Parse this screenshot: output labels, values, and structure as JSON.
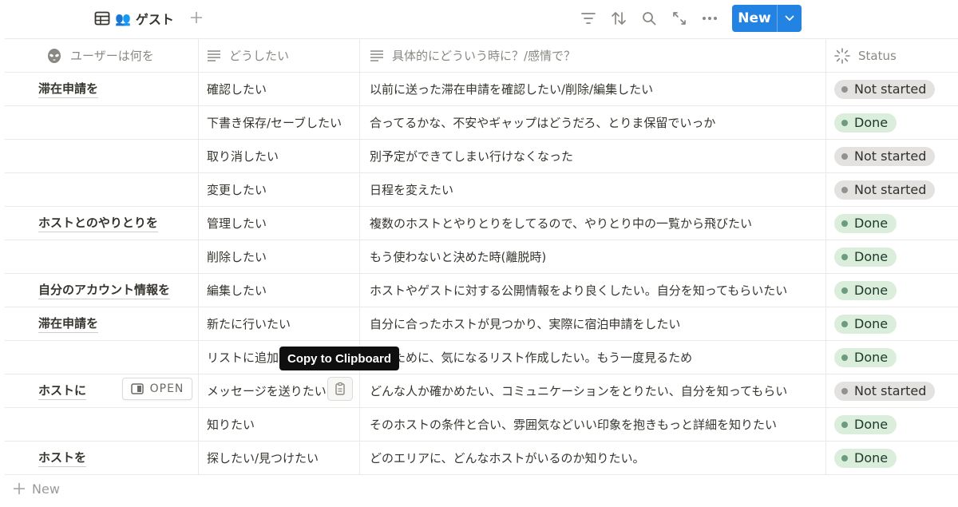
{
  "view": {
    "icon": "table-icon",
    "emoji": "👥",
    "name": "ゲスト"
  },
  "toolbar": {
    "new_label": "New"
  },
  "columns": [
    {
      "label": "ユーザーは何を",
      "icon": "alien-icon"
    },
    {
      "label": "どうしたい",
      "icon": "text-lines-icon"
    },
    {
      "label": "具体的にどういう時に？/感情で？",
      "icon": "text-lines-icon"
    },
    {
      "label": "Status",
      "icon": "status-spinner-icon"
    }
  ],
  "rows": [
    {
      "who": "滞在申請を",
      "want": "確認したい",
      "detail": "以前に送った滞在申請を確認したい/削除/編集したい",
      "status": "Not started"
    },
    {
      "who": "",
      "want": "下書き保存/セーブしたい",
      "detail": "合ってるかな、不安やギャップはどうだろ、とりま保留でいっか",
      "status": "Done"
    },
    {
      "who": "",
      "want": "取り消したい",
      "detail": "別予定ができてしまい行けなくなった",
      "status": "Not started"
    },
    {
      "who": "",
      "want": "変更したい",
      "detail": "日程を変えたい",
      "status": "Not started"
    },
    {
      "who": "ホストとのやりとりを",
      "want": "管理したい",
      "detail": "複数のホストとやりとりをしてるので、やりとり中の一覧から飛びたい",
      "status": "Done"
    },
    {
      "who": "",
      "want": "削除したい",
      "detail": "もう使わないと決めた時(離脱時)",
      "status": "Done"
    },
    {
      "who": "自分のアカウント情報を",
      "want": "編集したい",
      "detail": "ホストやゲストに対する公開情報をより良くしたい。自分を知ってもらいたい",
      "status": "Done"
    },
    {
      "who": "滞在申請を",
      "want": "新たに行いたい",
      "detail": "自分に合ったホストが見つかり、実際に宿泊申請をしたい",
      "status": "Done"
    },
    {
      "who": "",
      "want": "リストに追加",
      "detail": "見るために、気になるリスト作成したい。もう一度見るため",
      "status": "Done"
    },
    {
      "who": "ホストに",
      "want": "メッセージを送りたい",
      "detail": "どんな人か確かめたい、コミュニケーションをとりたい、自分を知ってもらい",
      "status": "Not started"
    },
    {
      "who": "",
      "want": "知りたい",
      "detail": "そのホストの条件と合い、雰囲気などいい印象を抱きもっと詳細を知りたい",
      "status": "Done"
    },
    {
      "who": "ホストを",
      "want": "探したい/見つけたい",
      "detail": "どのエリアに、どんなホストがいるのか知りたい。",
      "status": "Done"
    }
  ],
  "new_row_label": "New",
  "overlay": {
    "open_label": "OPEN",
    "tooltip": "Copy to Clipboard"
  }
}
